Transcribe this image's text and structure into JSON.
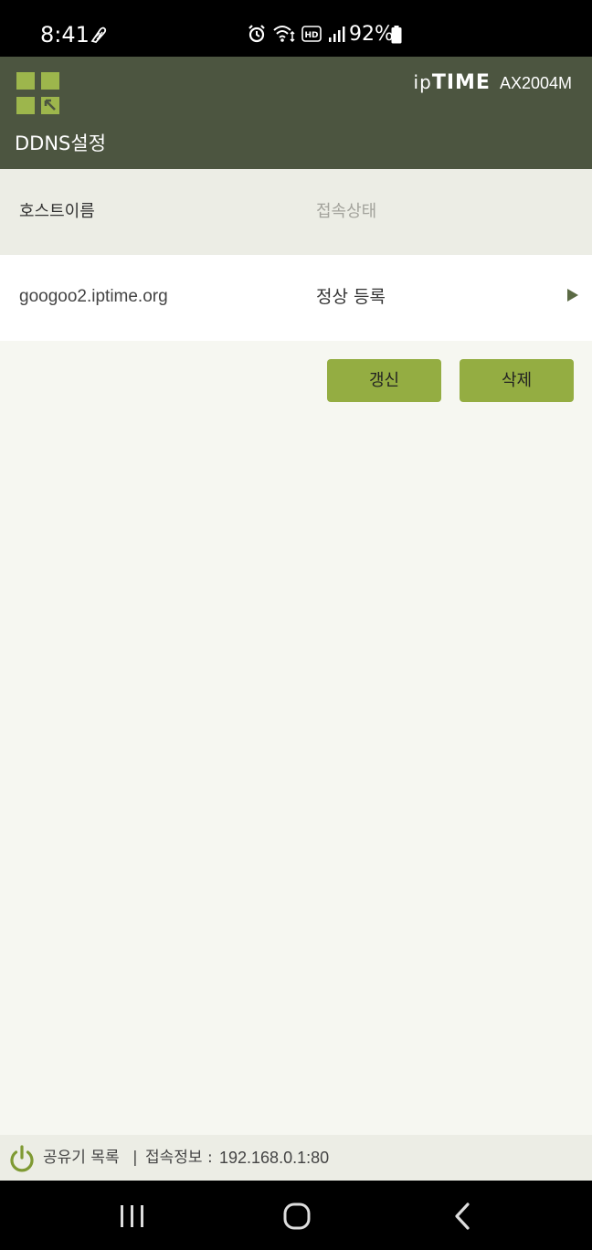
{
  "status_bar": {
    "time": "8:41",
    "battery_percent": "92%",
    "icons": [
      "runner-icon",
      "alarm-icon",
      "wifi-icon",
      "hd-icon",
      "signal-icon",
      "battery-icon"
    ]
  },
  "header": {
    "brand_ip": "ip",
    "brand_time": "TIME",
    "model": "AX2004M",
    "page_title": "DDNS설정",
    "colors": {
      "background": "#4c5540",
      "menu_accent": "#9db64c"
    }
  },
  "table": {
    "columns": [
      "호스트이름",
      "접속상태"
    ],
    "rows": [
      {
        "host": "googoo2.iptime.org",
        "status": "정상 등록"
      }
    ]
  },
  "actions": {
    "refresh_label": "갱신",
    "delete_label": "삭제",
    "button_color": "#94ad42"
  },
  "footer": {
    "router_list": "공유기 목록",
    "separator": "|",
    "connection_label": "접속정보 :",
    "connection_value": "192.168.0.1:80"
  }
}
